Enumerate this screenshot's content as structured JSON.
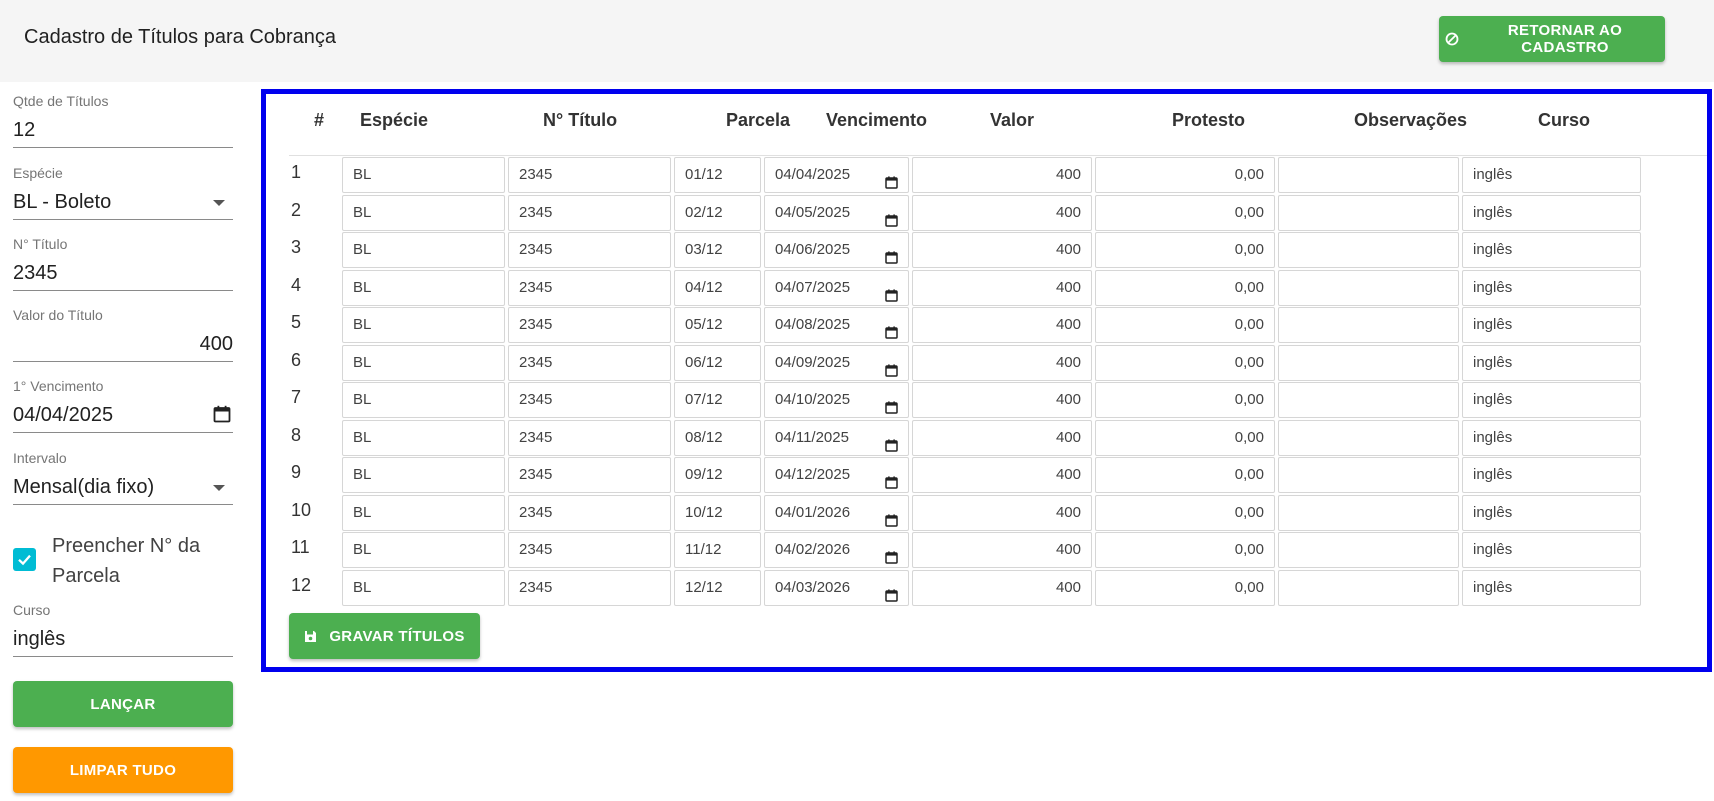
{
  "header": {
    "title": "Cadastro de Títulos para Cobrança",
    "return_label": "RETORNAR AO CADASTRO",
    "return_icon": "cancel-icon"
  },
  "form": {
    "qtd_label": "Qtde de Títulos",
    "qtd_value": "12",
    "especie_label": "Espécie",
    "especie_value": "BL - Boleto",
    "titulo_label": "N° Título",
    "titulo_value": "2345",
    "valor_label": "Valor do Título",
    "valor_value": "400",
    "venc_label": "1° Vencimento",
    "venc_value": "04/04/2025",
    "intervalo_label": "Intervalo",
    "intervalo_value": "Mensal(dia fixo)",
    "preencher_label": "Preencher N° da Parcela",
    "preencher_checked": true,
    "curso_label": "Curso",
    "curso_value": "inglês",
    "lancar_label": "LANÇAR",
    "limpar_label": "LIMPAR TUDO"
  },
  "table": {
    "headers": [
      "#",
      "Espécie",
      "N° Título",
      "Parcela",
      "Vencimento",
      "Valor",
      "Protesto",
      "Observações",
      "Curso"
    ],
    "rows": [
      {
        "num": "1",
        "especie": "BL",
        "titulo": "2345",
        "parcela": "01/12",
        "vencimento": "04/04/2025",
        "valor": "400",
        "protesto": "0,00",
        "observacoes": "",
        "curso": "inglês"
      },
      {
        "num": "2",
        "especie": "BL",
        "titulo": "2345",
        "parcela": "02/12",
        "vencimento": "04/05/2025",
        "valor": "400",
        "protesto": "0,00",
        "observacoes": "",
        "curso": "inglês"
      },
      {
        "num": "3",
        "especie": "BL",
        "titulo": "2345",
        "parcela": "03/12",
        "vencimento": "04/06/2025",
        "valor": "400",
        "protesto": "0,00",
        "observacoes": "",
        "curso": "inglês"
      },
      {
        "num": "4",
        "especie": "BL",
        "titulo": "2345",
        "parcela": "04/12",
        "vencimento": "04/07/2025",
        "valor": "400",
        "protesto": "0,00",
        "observacoes": "",
        "curso": "inglês"
      },
      {
        "num": "5",
        "especie": "BL",
        "titulo": "2345",
        "parcela": "05/12",
        "vencimento": "04/08/2025",
        "valor": "400",
        "protesto": "0,00",
        "observacoes": "",
        "curso": "inglês"
      },
      {
        "num": "6",
        "especie": "BL",
        "titulo": "2345",
        "parcela": "06/12",
        "vencimento": "04/09/2025",
        "valor": "400",
        "protesto": "0,00",
        "observacoes": "",
        "curso": "inglês"
      },
      {
        "num": "7",
        "especie": "BL",
        "titulo": "2345",
        "parcela": "07/12",
        "vencimento": "04/10/2025",
        "valor": "400",
        "protesto": "0,00",
        "observacoes": "",
        "curso": "inglês"
      },
      {
        "num": "8",
        "especie": "BL",
        "titulo": "2345",
        "parcela": "08/12",
        "vencimento": "04/11/2025",
        "valor": "400",
        "protesto": "0,00",
        "observacoes": "",
        "curso": "inglês"
      },
      {
        "num": "9",
        "especie": "BL",
        "titulo": "2345",
        "parcela": "09/12",
        "vencimento": "04/12/2025",
        "valor": "400",
        "protesto": "0,00",
        "observacoes": "",
        "curso": "inglês"
      },
      {
        "num": "10",
        "especie": "BL",
        "titulo": "2345",
        "parcela": "10/12",
        "vencimento": "04/01/2026",
        "valor": "400",
        "protesto": "0,00",
        "observacoes": "",
        "curso": "inglês"
      },
      {
        "num": "11",
        "especie": "BL",
        "titulo": "2345",
        "parcela": "11/12",
        "vencimento": "04/02/2026",
        "valor": "400",
        "protesto": "0,00",
        "observacoes": "",
        "curso": "inglês"
      },
      {
        "num": "12",
        "especie": "BL",
        "titulo": "2345",
        "parcela": "12/12",
        "vencimento": "04/03/2026",
        "valor": "400",
        "protesto": "0,00",
        "observacoes": "",
        "curso": "inglês"
      }
    ],
    "gravar_label": "GRAVAR TÍTULOS",
    "gravar_icon": "save-icon"
  },
  "colors": {
    "green": "#4caf50",
    "orange": "#ff9800",
    "panel_border": "#0000ee",
    "checkbox": "#00bcd4"
  }
}
